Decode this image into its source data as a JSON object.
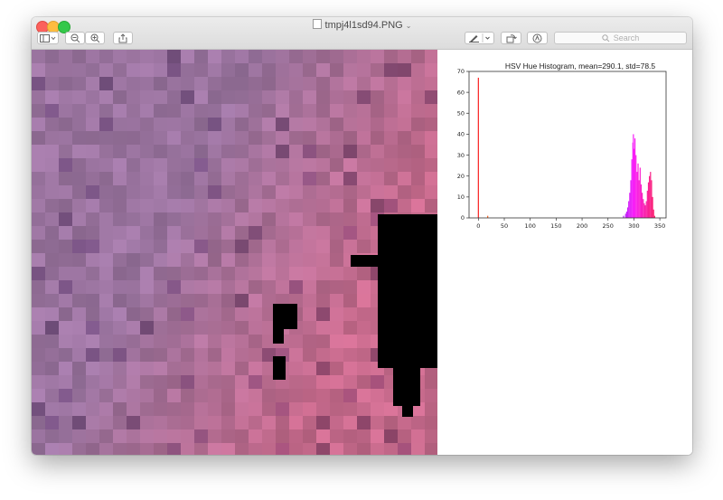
{
  "window": {
    "title": "tmpj4l1sd94.PNG",
    "search_placeholder": "Search"
  },
  "image": {
    "description_colors": [
      "#a67fa8",
      "#b084ab",
      "#9d7aa2",
      "#c58fb5",
      "#cf85b0"
    ]
  },
  "chart_data": {
    "type": "bar",
    "title": "HSV Hue Histogram, mean=290.1, std=78.5",
    "xlabel": "",
    "ylabel": "",
    "xlim": [
      -18,
      362
    ],
    "ylim": [
      0,
      70
    ],
    "xticks": [
      0,
      50,
      100,
      150,
      200,
      250,
      300,
      350
    ],
    "yticks": [
      0,
      10,
      20,
      30,
      40,
      50,
      60,
      70
    ],
    "bars": [
      {
        "x": 0,
        "y": 67
      },
      {
        "x": 18,
        "y": 1
      },
      {
        "x": 280,
        "y": 1
      },
      {
        "x": 284,
        "y": 2
      },
      {
        "x": 286,
        "y": 3
      },
      {
        "x": 288,
        "y": 5
      },
      {
        "x": 290,
        "y": 8
      },
      {
        "x": 292,
        "y": 12
      },
      {
        "x": 294,
        "y": 18
      },
      {
        "x": 296,
        "y": 28
      },
      {
        "x": 298,
        "y": 36
      },
      {
        "x": 299,
        "y": 40
      },
      {
        "x": 300,
        "y": 33
      },
      {
        "x": 302,
        "y": 38
      },
      {
        "x": 304,
        "y": 30
      },
      {
        "x": 306,
        "y": 22
      },
      {
        "x": 308,
        "y": 26
      },
      {
        "x": 310,
        "y": 18
      },
      {
        "x": 312,
        "y": 24
      },
      {
        "x": 314,
        "y": 16
      },
      {
        "x": 316,
        "y": 12
      },
      {
        "x": 318,
        "y": 9
      },
      {
        "x": 320,
        "y": 7
      },
      {
        "x": 322,
        "y": 6
      },
      {
        "x": 324,
        "y": 8
      },
      {
        "x": 326,
        "y": 13
      },
      {
        "x": 328,
        "y": 17
      },
      {
        "x": 330,
        "y": 20
      },
      {
        "x": 332,
        "y": 22
      },
      {
        "x": 334,
        "y": 18
      },
      {
        "x": 336,
        "y": 10
      },
      {
        "x": 338,
        "y": 4
      },
      {
        "x": 340,
        "y": 1
      }
    ]
  }
}
